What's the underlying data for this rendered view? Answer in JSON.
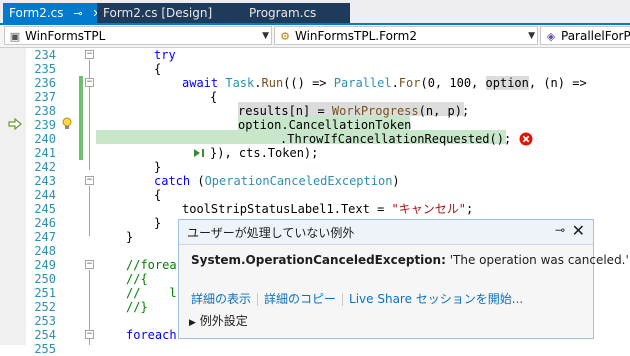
{
  "tabs": [
    {
      "label": "Form2.cs",
      "active": true,
      "pin": "⊸",
      "close": "✕"
    },
    {
      "label": "Form2.cs [Design]",
      "active": false
    },
    {
      "label": "Program.cs",
      "active": false
    }
  ],
  "navbar": {
    "project": "WinFormsTPL",
    "class": "WinFormsTPL.Form2",
    "member": "ParallelForPr"
  },
  "code_lines": [
    {
      "num": "234",
      "code": "try"
    },
    {
      "num": "235",
      "code": "{"
    },
    {
      "num": "236",
      "code": "await Task.Run(() => Parallel.For(0, 100, option, (n) =>"
    },
    {
      "num": "237",
      "code": "{"
    },
    {
      "num": "238",
      "code": "results[n] = WorkProgress(n, p);"
    },
    {
      "num": "239",
      "code": "option.CancellationToken"
    },
    {
      "num": "240",
      "code": ".ThrowIfCancellationRequested();"
    },
    {
      "num": "241",
      "code": "}), cts.Token);"
    },
    {
      "num": "242",
      "code": "}"
    },
    {
      "num": "243",
      "code": "catch (OperationCanceledException)"
    },
    {
      "num": "244",
      "code": "{"
    },
    {
      "num": "245",
      "code": "toolStripStatusLabel1.Text = \"キャンセル\";"
    },
    {
      "num": "246",
      "code": "}"
    },
    {
      "num": "247",
      "code": "}"
    },
    {
      "num": "248",
      "code": ""
    },
    {
      "num": "249",
      "code": "//forea"
    },
    {
      "num": "250",
      "code": "//{"
    },
    {
      "num": "251",
      "code": "//    l"
    },
    {
      "num": "252",
      "code": "//}"
    },
    {
      "num": "253",
      "code": ""
    },
    {
      "num": "254",
      "code": "foreach"
    },
    {
      "num": "255",
      "code": "{"
    }
  ],
  "exception_popup": {
    "title": "ユーザーが処理していない例外",
    "exception_type": "System.OperationCanceledException:",
    "message": "'The operation was canceled.'",
    "links": [
      "詳細の表示",
      "詳細のコピー",
      "Live Share セッションを開始..."
    ],
    "settings": "例外設定"
  },
  "colors": {
    "accent": "#007acc",
    "highlight": "#c8e6c9",
    "error": "#e51400"
  }
}
